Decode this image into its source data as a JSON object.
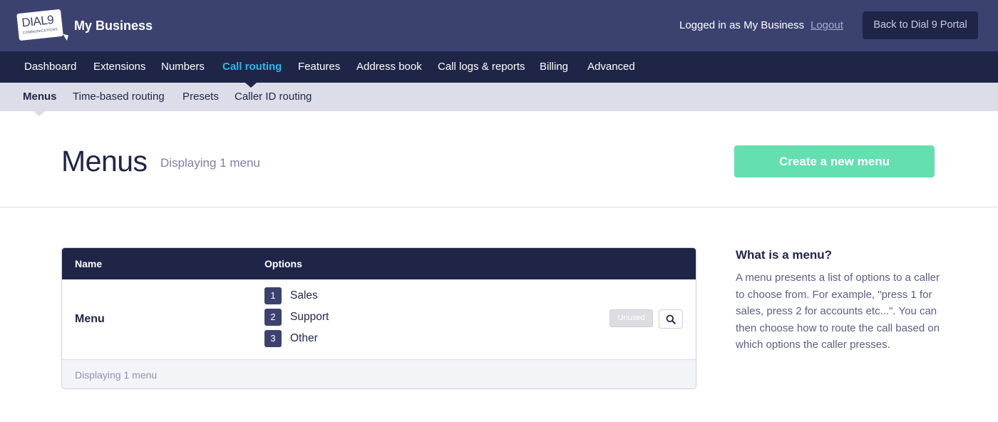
{
  "header": {
    "logo_text": "DIAL9",
    "logo_subtext": "COMMUNICATIONS",
    "brand_name": "My Business",
    "logged_in_text": "Logged in as My Business",
    "logout_label": "Logout",
    "back_button_label": "Back to Dial 9 Portal"
  },
  "main_nav": {
    "items": [
      {
        "label": "Dashboard",
        "active": false
      },
      {
        "label": "Extensions",
        "active": false
      },
      {
        "label": "Numbers",
        "active": false
      },
      {
        "label": "Call routing",
        "active": true
      },
      {
        "label": "Features",
        "active": false
      },
      {
        "label": "Address book",
        "active": false
      },
      {
        "label": "Call logs & reports",
        "active": false
      },
      {
        "label": "Billing",
        "active": false
      },
      {
        "label": "Advanced",
        "active": false
      }
    ]
  },
  "sub_nav": {
    "items": [
      {
        "label": "Menus",
        "active": true
      },
      {
        "label": "Time-based routing",
        "active": false
      },
      {
        "label": "Presets",
        "active": false
      },
      {
        "label": "Caller ID routing",
        "active": false
      }
    ]
  },
  "page": {
    "title": "Menus",
    "count_text": "Displaying 1 menu",
    "create_button_label": "Create a new menu"
  },
  "table": {
    "columns": [
      "Name",
      "Options"
    ],
    "rows": [
      {
        "name": "Menu",
        "options": [
          {
            "number": "1",
            "label": "Sales"
          },
          {
            "number": "2",
            "label": "Support"
          },
          {
            "number": "3",
            "label": "Other"
          }
        ],
        "status_badge": "Unused",
        "action_icon": "search-icon"
      }
    ],
    "footer_text": "Displaying 1 menu"
  },
  "help": {
    "title": "What is a menu?",
    "body": "A menu presents a list of options to a caller to choose from. For example, \"press 1 for sales, press 2 for accounts etc...\". You can then choose how to route the call based on which options the caller presses."
  },
  "colors": {
    "header_bg": "#3b4270",
    "nav_bg": "#1f2547",
    "active_nav": "#2bb8ea",
    "subnav_bg": "#dcdde8",
    "create_button": "#63dfb0"
  }
}
